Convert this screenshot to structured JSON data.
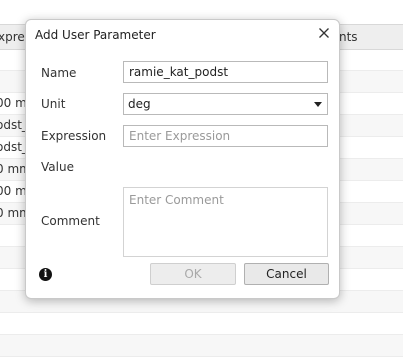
{
  "background": {
    "header_left": "xpre",
    "header_right": "nts",
    "rows": [
      {
        "text": ""
      },
      {
        "text": ""
      },
      {
        "text": "00 mm"
      },
      {
        "text": "odst_"
      },
      {
        "text": "odst_"
      },
      {
        "text": "0 mm"
      },
      {
        "text": "00 mm"
      },
      {
        "text": "0 mm"
      },
      {
        "text": ""
      },
      {
        "text": ""
      },
      {
        "text": ""
      },
      {
        "text": ""
      },
      {
        "text": ""
      },
      {
        "text": ""
      }
    ]
  },
  "dialog": {
    "title": "Add User Parameter",
    "close_icon": "close-icon",
    "name_label": "Name",
    "name_value": "ramie_kat_podst",
    "unit_label": "Unit",
    "unit_value": "deg",
    "expression_label": "Expression",
    "expression_placeholder": "Enter Expression",
    "value_label": "Value",
    "comment_label": "Comment",
    "comment_placeholder": "Enter Comment",
    "info_icon": "info-icon",
    "ok_label": "OK",
    "cancel_label": "Cancel"
  }
}
